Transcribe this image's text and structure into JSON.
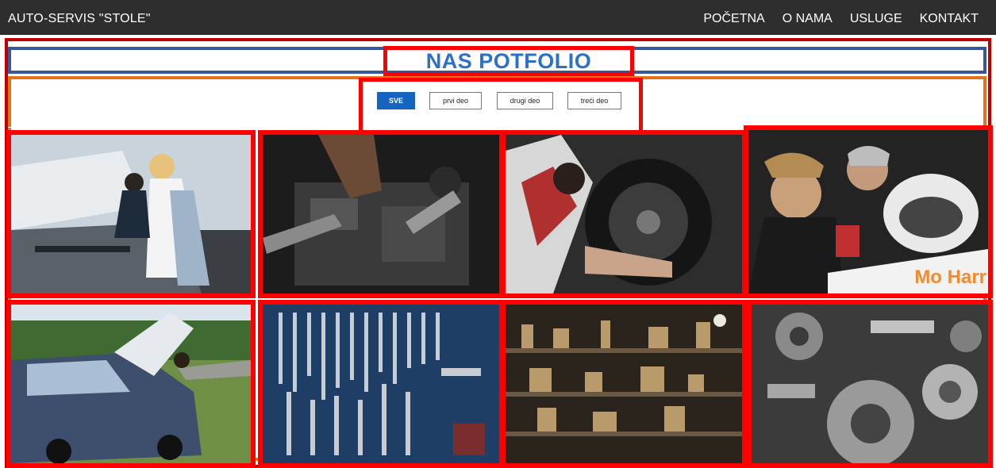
{
  "navbar": {
    "brand": "AUTO-SERVIS \"STOLE\"",
    "links": [
      "POČETNA",
      "O NAMA",
      "USLUGE",
      "KONTAKT"
    ]
  },
  "portfolio": {
    "title": "NAS POTFOLIO",
    "filters": [
      {
        "label": "SVE",
        "active": true
      },
      {
        "label": "prvi deo",
        "active": false
      },
      {
        "label": "drugi deo",
        "active": false
      },
      {
        "label": "treći deo",
        "active": false
      }
    ],
    "images": [
      {
        "name": "mechanics-under-hood-photo",
        "caption": ""
      },
      {
        "name": "engine-wrench-photo",
        "caption": ""
      },
      {
        "name": "wheel-repair-photo",
        "caption": ""
      },
      {
        "name": "racing-team-photo",
        "caption": "Mo Harr"
      },
      {
        "name": "car-hood-open-photo",
        "caption": ""
      },
      {
        "name": "wrench-wall-photo",
        "caption": ""
      },
      {
        "name": "workshop-shelf-photo",
        "caption": ""
      },
      {
        "name": "gears-parts-photo",
        "caption": ""
      }
    ]
  },
  "colors": {
    "navbar": "#2e2e2e",
    "title": "#2b71c7",
    "active_filter": "#1565c0",
    "highlight_red": "#ff0000",
    "band_orange": "#e2731b",
    "band_blue": "#35589a"
  }
}
